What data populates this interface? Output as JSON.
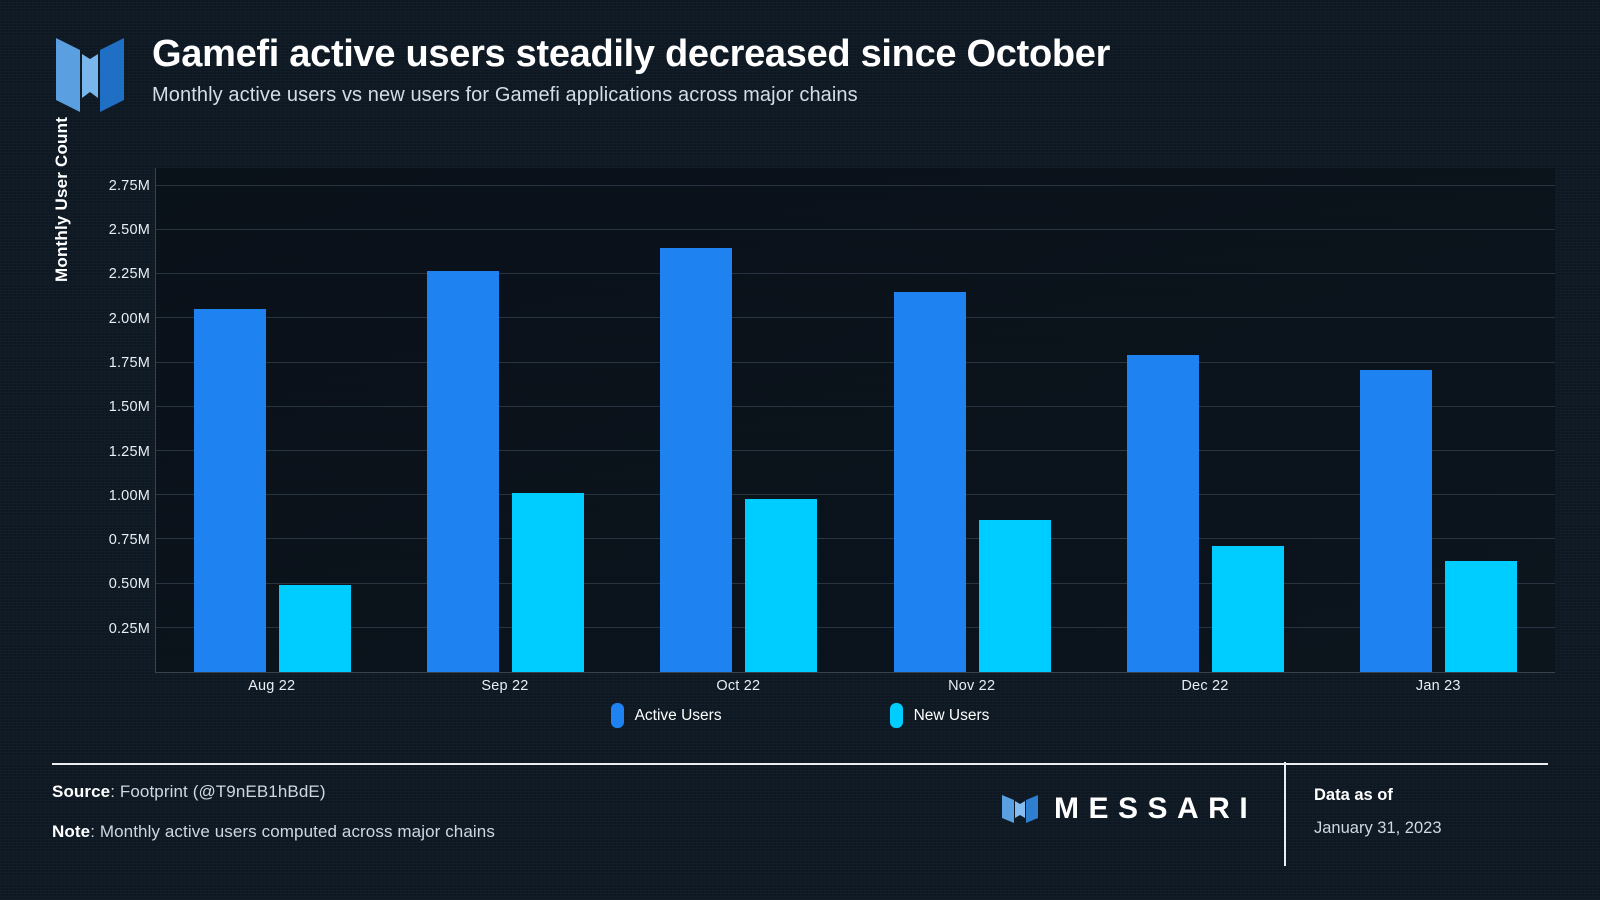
{
  "header": {
    "logo_icon": "messari-m-logo",
    "title": "Gamefi active users steadily decreased since October",
    "subtitle": "Monthly active users vs new users for Gamefi applications across major chains"
  },
  "legend": {
    "items": [
      {
        "label": "Active Users",
        "color": "#1e82f0"
      },
      {
        "label": "New Users",
        "color": "#00cdff"
      }
    ]
  },
  "footer": {
    "source_label": "Source",
    "source_value": ": Footprint (@T9nEB1hBdE)",
    "note_label": "Note",
    "note_value": ": Monthly active users computed across major chains",
    "brand_wordmark": "MESSARI",
    "brand_icon": "messari-m-logo",
    "data_as_of_label": "Data as of",
    "data_as_of_date": "January 31, 2023"
  },
  "chart_data": {
    "type": "bar",
    "title": "Gamefi active users steadily decreased since October",
    "subtitle": "Monthly active users vs new users for Gamefi applications across major chains",
    "xlabel": "",
    "ylabel": "Monthly User Count",
    "ylim": [
      0,
      2.85
    ],
    "y_unit": "M",
    "grid": true,
    "legend_position": "bottom-center",
    "categories": [
      "Aug 22",
      "Sep 22",
      "Oct 22",
      "Nov 22",
      "Dec 22",
      "Jan 23"
    ],
    "y_ticks": [
      0.25,
      0.5,
      0.75,
      1.0,
      1.25,
      1.5,
      1.75,
      2.0,
      2.25,
      2.5,
      2.75
    ],
    "y_tick_labels": [
      "0.25M",
      "0.50M",
      "0.75M",
      "1.00M",
      "1.25M",
      "1.50M",
      "1.75M",
      "2.00M",
      "2.25M",
      "2.50M",
      "2.75M"
    ],
    "series": [
      {
        "name": "Active Users",
        "color": "#1e82f0",
        "values": [
          2.05,
          2.27,
          2.4,
          2.15,
          1.79,
          1.71
        ]
      },
      {
        "name": "New Users",
        "color": "#00cdff",
        "values": [
          0.49,
          1.01,
          0.98,
          0.86,
          0.71,
          0.63
        ]
      }
    ]
  }
}
